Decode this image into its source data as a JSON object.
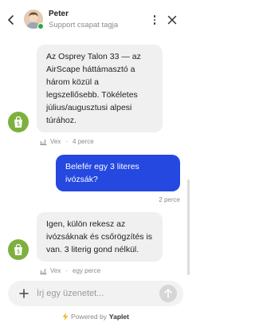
{
  "header": {
    "agent_name": "Peter",
    "agent_role": "Support csapat tagja"
  },
  "messages": [
    {
      "direction": "in",
      "text": "Az Osprey Talon 33 — az AirScape háttámasztó a három közül a legszellősebb. Tökéletes július/augusztusi alpesi túrához.",
      "author": "Vex",
      "time": "4 perce"
    },
    {
      "direction": "out",
      "text": "Belefér egy 3 literes ivózsák?",
      "time": "2 perce"
    },
    {
      "direction": "in",
      "text": "Igen, külön rekesz az ivózsáknak és csőrögzítés is van. 3 literig gond nélkül.",
      "author": "Vex",
      "time": "egy perce"
    }
  ],
  "composer": {
    "placeholder": "Írj egy üzenetet..."
  },
  "footer": {
    "powered_prefix": "Powered by",
    "brand": "Yaplet"
  },
  "colors": {
    "accent": "#2448e0",
    "bot_avatar": "#7eb03e",
    "online": "#29a847",
    "bubble_in": "#f0f0f0"
  }
}
